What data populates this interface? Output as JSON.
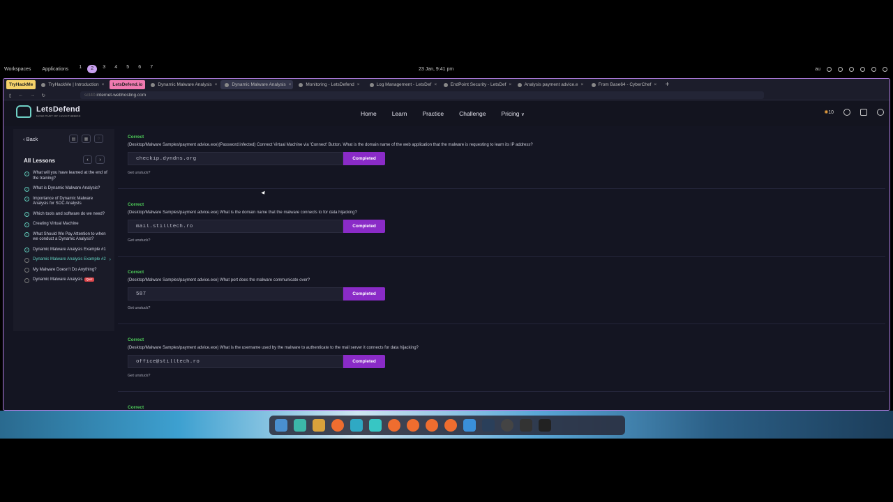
{
  "workspace_bar": {
    "workspaces_label": "Workspaces",
    "applications_label": "Applications",
    "numbers": [
      "1",
      "2",
      "3",
      "4",
      "5",
      "6",
      "7"
    ],
    "active_index": 1,
    "clock": "23 Jan, 9:41 pm",
    "tray_label": "au"
  },
  "browser": {
    "tabs": [
      {
        "label": "TryHackMe",
        "style": "pin1"
      },
      {
        "label": "TryHackMe | Introduction",
        "style": ""
      },
      {
        "label": "LetsDefend.io",
        "style": "pin2"
      },
      {
        "label": "Dynamic Malware Analysis",
        "style": ""
      },
      {
        "label": "Dynamic Malware Analysis",
        "style": "sel"
      },
      {
        "label": "Monitoring - LetsDefend",
        "style": ""
      },
      {
        "label": "Log Management - LetsDef",
        "style": ""
      },
      {
        "label": "EndPoint Security - LetsDef",
        "style": ""
      },
      {
        "label": "Analysis payment advice.e",
        "style": ""
      },
      {
        "label": "From Base64 - CyberChef",
        "style": ""
      }
    ],
    "url_prefix": "sct40.",
    "url_host": "internet-webhosting.com"
  },
  "site": {
    "logo_name": "LetsDefend",
    "logo_sub": "NOW PART OF HACKTHEBOX",
    "nav": [
      "Home",
      "Learn",
      "Practice",
      "Challenge"
    ],
    "pricing_label": "Pricing",
    "coins": "10"
  },
  "sidebar": {
    "back_label": "Back",
    "all_lessons_label": "All Lessons",
    "lessons": [
      {
        "title": "What will you have learned at the end of the training?",
        "done": true,
        "current": false
      },
      {
        "title": "What is Dynamic Malware Analysis?",
        "done": true,
        "current": false
      },
      {
        "title": "Importance of Dynamic Malware Analysis for SOC Analysts",
        "done": true,
        "current": false
      },
      {
        "title": "Which tools and software do we need?",
        "done": true,
        "current": false
      },
      {
        "title": "Creating Virtual Machine",
        "done": true,
        "current": false
      },
      {
        "title": "What Should We Pay Attention to when we conduct a Dynamic Analysis?",
        "done": true,
        "current": false
      },
      {
        "title": "Dynamic Malware Analysis Example #1",
        "done": true,
        "current": false
      },
      {
        "title": "Dynamic Malware Analysis Example #2",
        "done": false,
        "current": true
      },
      {
        "title": "My Malware Doesn't Do Anything?",
        "done": false,
        "current": false
      },
      {
        "title": "Dynamic Malware Analysis",
        "done": false,
        "current": false,
        "badge": "Quiz"
      }
    ]
  },
  "questions": [
    {
      "status": "Correct",
      "text": "(Desktop/Malware Samples/payment advice.exe)(Password:infected) Connect Virtual Machine via 'Connect' Button. What is the domain name of the web application that the malware is requesting to learn its IP address?",
      "answer": "checkip.dyndns.org",
      "button": "Completed",
      "unstuck": "Get unstuck?"
    },
    {
      "status": "Correct",
      "text": "(Desktop/Malware Samples/payment advice.exe) What is the domain name that the malware connects to for data hijacking?",
      "answer": "mail.stilltech.ro",
      "button": "Completed",
      "unstuck": "Get unstuck?"
    },
    {
      "status": "Correct",
      "text": "(Desktop/Malware Samples/payment advice.exe) What port does the malware communicate over?",
      "answer": "587",
      "button": "Completed",
      "unstuck": "Get unstuck?"
    },
    {
      "status": "Correct",
      "text": "(Desktop/Malware Samples/payment advice.exe) What is the username used by the malware to authenticate to the mail server it connects for data hijacking?",
      "answer": "office@stilltech.ro",
      "button": "Completed",
      "unstuck": "Get unstuck?"
    },
    {
      "status": "Correct",
      "text": "",
      "answer": "",
      "button": "",
      "unstuck": ""
    }
  ],
  "colors": {
    "accent_purple": "#8a2bc7",
    "correct_green": "#4fd05a",
    "teal": "#62d3c2"
  }
}
